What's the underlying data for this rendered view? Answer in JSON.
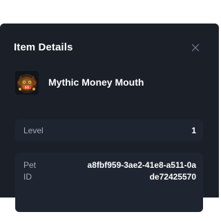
{
  "dialog": {
    "title": "Item Details",
    "close_icon": "close-icon"
  },
  "item": {
    "name": "Mythic Money Mouth",
    "image_icon": "money-mouth-pet-image"
  },
  "details": {
    "level_label": "Level",
    "level_value": "1",
    "pet_id_label": "Pet ID",
    "pet_id_value": "a8fbf959-3ae2-41e8-a511-0ade72425570"
  },
  "colors": {
    "modal_background": "#1a1f28",
    "card_background": "#1f2530",
    "label_text": "#a5abb5",
    "value_text": "#ffffff"
  }
}
